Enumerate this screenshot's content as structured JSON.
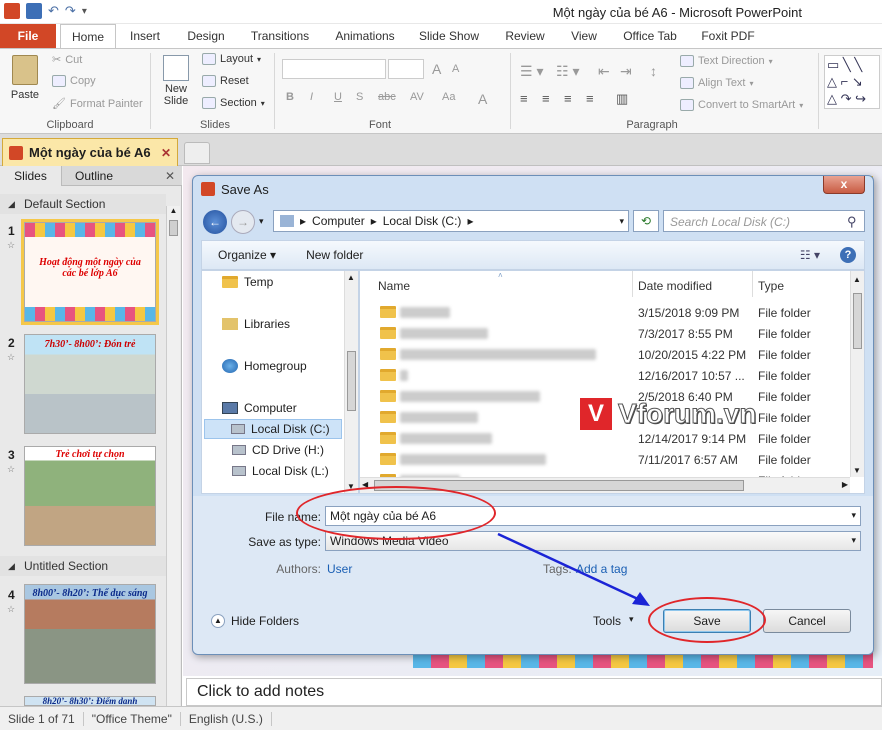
{
  "app": {
    "window_title": "Một ngày của bé A6  -  Microsoft PowerPoint"
  },
  "ribbon": {
    "tabs": [
      "File",
      "Home",
      "Insert",
      "Design",
      "Transitions",
      "Animations",
      "Slide Show",
      "Review",
      "View",
      "Office Tab",
      "Foxit PDF"
    ],
    "clipboard": {
      "paste": "Paste",
      "cut": "Cut",
      "copy": "Copy",
      "format_painter": "Format Painter",
      "label": "Clipboard"
    },
    "slides": {
      "new_slide_1": "New",
      "new_slide_2": "Slide",
      "layout": "Layout",
      "reset": "Reset",
      "section": "Section",
      "label": "Slides"
    },
    "font": {
      "bold": "B",
      "italic": "I",
      "underline": "U",
      "strike": "S",
      "abc": "abc",
      "spacing": "AV",
      "case": "Aa",
      "color": "A",
      "grow": "A",
      "shrink": "A",
      "label": "Font"
    },
    "paragraph": {
      "text_direction": "Text Direction",
      "align_text": "Align Text",
      "convert_smartart": "Convert to SmartArt",
      "label": "Paragraph"
    }
  },
  "doc_tab": {
    "label": "Một ngày của bé A6"
  },
  "slides_panel": {
    "tabs": [
      "Slides",
      "Outline"
    ],
    "sections": [
      "Default Section",
      "Untitled Section"
    ],
    "thumbs": [
      {
        "num": "1",
        "caption": "Hoạt động một ngày của các bé lớp A6"
      },
      {
        "num": "2",
        "caption": "7h30’- 8h00’: Đón trẻ"
      },
      {
        "num": "3",
        "caption": "Trẻ chơi tự chọn"
      },
      {
        "num": "4",
        "caption": "8h00’- 8h20’: Thể dục sáng"
      },
      {
        "num": "",
        "caption": "8h20’- 8h30’: Điểm danh"
      }
    ]
  },
  "notes": {
    "placeholder": "Click to add notes"
  },
  "statusbar": {
    "slide": "Slide 1 of 71",
    "theme": "\"Office Theme\"",
    "language": "English (U.S.)"
  },
  "dialog": {
    "title": "Save As",
    "close": "x",
    "breadcrumb": [
      "Computer",
      "Local Disk (C:)"
    ],
    "search_placeholder": "Search Local Disk (C:)",
    "organize": "Organize",
    "new_folder": "New folder",
    "nav": [
      {
        "label": "Temp",
        "icon": "folder-icon"
      },
      {
        "label": "Libraries",
        "icon": "libraries-icon"
      },
      {
        "label": "Homegroup",
        "icon": "homegroup-icon"
      },
      {
        "label": "Computer",
        "icon": "computer-icon"
      },
      {
        "label": "Local Disk (C:)",
        "icon": "disk-icon"
      },
      {
        "label": "CD Drive (H:)",
        "icon": "cd-icon"
      },
      {
        "label": "Local Disk (L:)",
        "icon": "disk-icon"
      }
    ],
    "columns": {
      "name": "Name",
      "date": "Date modified",
      "type": "Type"
    },
    "files": [
      {
        "date": "3/15/2018 9:09 PM",
        "type": "File folder"
      },
      {
        "date": "7/3/2017 8:55 PM",
        "type": "File folder"
      },
      {
        "date": "10/20/2015 4:22 PM",
        "type": "File folder"
      },
      {
        "date": "12/16/2017 10:57 ...",
        "type": "File folder"
      },
      {
        "date": "2/5/2018 6:40 PM",
        "type": "File folder"
      },
      {
        "date": "",
        "type": "File folder"
      },
      {
        "date": "12/14/2017 9:14 PM",
        "type": "File folder"
      },
      {
        "date": "7/11/2017 6:57 AM",
        "type": "File folder"
      },
      {
        "date": "",
        "type": "File folder"
      }
    ],
    "file_name_label": "File name:",
    "file_name_value": "Một ngày của bé A6",
    "save_as_type_label": "Save as type:",
    "save_as_type_value": "Windows Media Video",
    "authors_label": "Authors:",
    "authors_value": "User",
    "tags_label": "Tags:",
    "tags_value": "Add a tag",
    "hide_folders": "Hide Folders",
    "tools": "Tools",
    "save": "Save",
    "cancel": "Cancel"
  },
  "watermark": {
    "text": "Vforum.vn",
    "logo": "V"
  },
  "colors": {
    "file_tab": "#d24726",
    "dialog_bg": "#cfe0f3",
    "highlight_red": "#e0262a",
    "arrow_blue": "#1b24d6",
    "watermark_red": "#e0262a"
  }
}
